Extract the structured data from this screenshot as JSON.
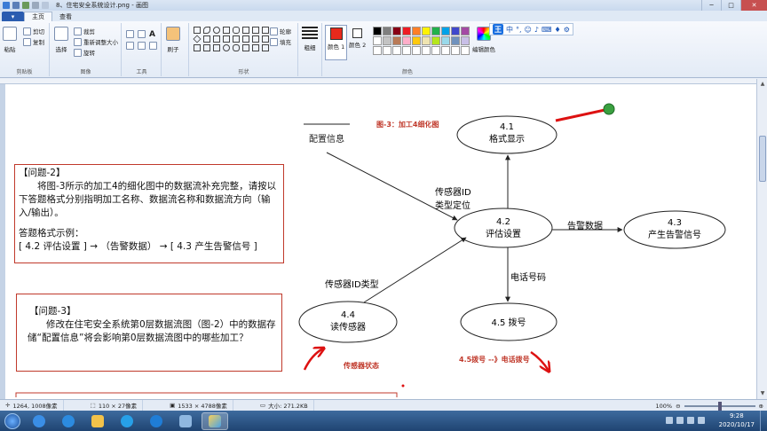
{
  "window": {
    "title": "8、住宅安全系统设计.png - 画图",
    "minimize": "─",
    "maximize": "□",
    "close": "✕"
  },
  "tabs": {
    "file": "▾",
    "home": "主页",
    "view": "查看"
  },
  "ribbon": {
    "clipboard": {
      "paste": "粘贴",
      "cut": "剪切",
      "copy": "复制",
      "label": "剪贴板"
    },
    "image": {
      "select": "选择",
      "crop": "裁剪",
      "resize": "重新调整大小",
      "rotate": "旋转",
      "label": "图像"
    },
    "tools": {
      "label": "工具",
      "text_tool": "A"
    },
    "brushes": {
      "label": "刷子"
    },
    "shapes": {
      "outline": "轮廓",
      "fill": "填充",
      "label": "形状"
    },
    "size": {
      "label": "粗细"
    },
    "colors": {
      "color1": "颜色 1",
      "color2": "颜色 2",
      "edit": "编辑颜色",
      "label": "颜色",
      "color1_value": "#e8291c",
      "color2_value": "#ffffff",
      "palette": [
        "#000000",
        "#7f7f7f",
        "#880015",
        "#ed1c24",
        "#ff7f27",
        "#fff200",
        "#22b14c",
        "#00a2e8",
        "#3f48cc",
        "#a349a4",
        "#ffffff",
        "#c3c3c3",
        "#b97a57",
        "#ffaec9",
        "#ffc90e",
        "#efe4b0",
        "#b5e61d",
        "#99d9ea",
        "#7092be",
        "#c8bfe7",
        "#ffffff",
        "#ffffff",
        "#ffffff",
        "#ffffff",
        "#ffffff",
        "#ffffff",
        "#ffffff",
        "#ffffff",
        "#ffffff",
        "#ffffff"
      ]
    }
  },
  "ime": {
    "logo": "王",
    "mode": "中"
  },
  "diagram": {
    "title": "图-3：加工4细化图",
    "store": "配置信息",
    "nodes": {
      "n41_id": "4.1",
      "n41_name": "格式显示",
      "n42_id": "4.2",
      "n42_name": "评估设置",
      "n43_id": "4.3",
      "n43_name": "产生告警信号",
      "n44_id": "4.4",
      "n44_name": "读传感器",
      "n45": "4.5  拨号"
    },
    "flows": {
      "sensor_id_type_line1": "传感器ID",
      "sensor_id_type_line2": "类型定位",
      "alarm_data": "告警数据",
      "phone_number": "电话号码",
      "sensor_id_type": "传感器ID类型"
    },
    "annotations": {
      "sensor_state": "传感器状态",
      "dial_phone": "4.5拨号 --》电话拨号"
    }
  },
  "questions": {
    "q2": {
      "title": "【问题-2】",
      "body": "将图-3所示的加工4的细化图中的数据流补充完整，请按以下答题格式分别指明加工名称、数据流名称和数据流方向（输入/输出）。",
      "format_label": "答题格式示例：",
      "example": "[ 4.2 评估设置 ] → （告警数据） → [ 4.3  产生告警信号 ]"
    },
    "q3": {
      "title": "【问题-3】",
      "body": "修改在住宅安全系统第0层数据流图（图-2）中的数据存储“配置信息”将会影响第0层数据流图中的哪些加工？"
    }
  },
  "status": {
    "cursor": "1264, 1008像素",
    "selection": "110 × 27像素",
    "image_size": "1533 × 4788像素",
    "file_size": "大小: 271.2KB",
    "zoom": "100%",
    "zoom_out": "⊖",
    "zoom_in": "⊕"
  },
  "taskbar": {
    "time": "9:28",
    "date": "2020/10/17"
  }
}
